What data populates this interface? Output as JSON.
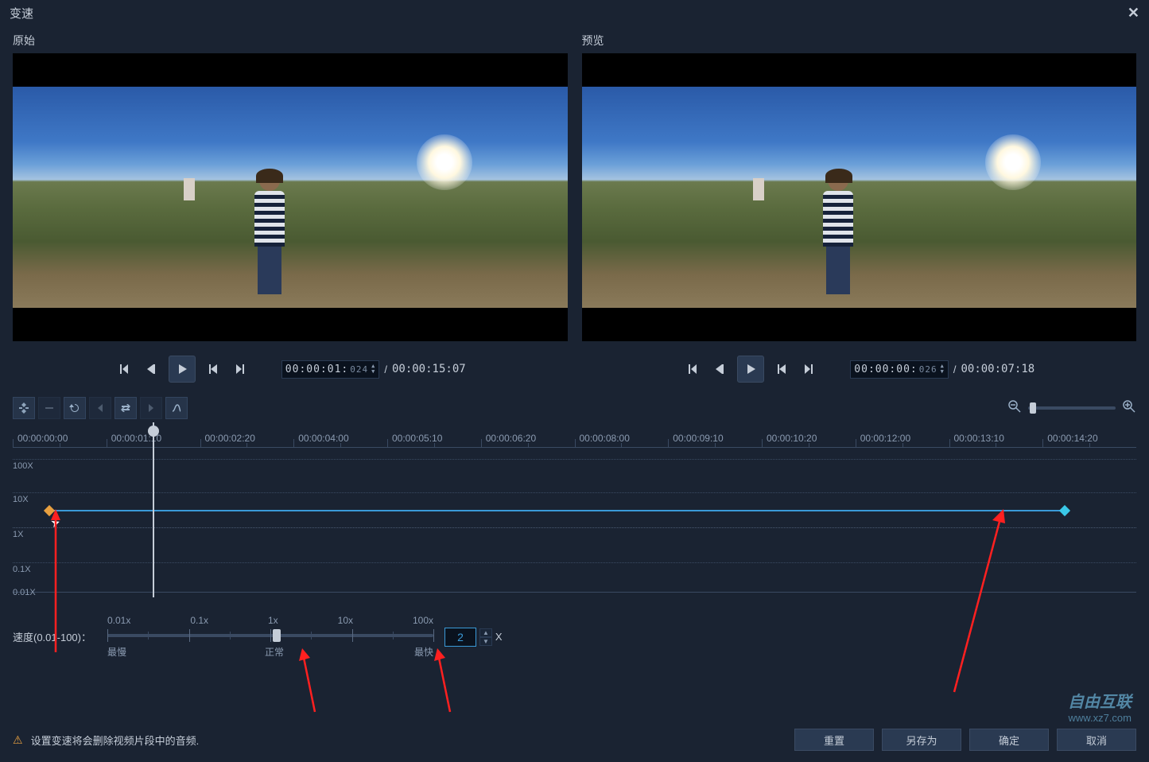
{
  "window": {
    "title": "变速"
  },
  "previews": {
    "original_label": "原始",
    "preview_label": "预览"
  },
  "playback": {
    "original": {
      "timecode_main": "00:00:01:",
      "timecode_frames": "024",
      "total": "00:00:15:07"
    },
    "preview": {
      "timecode_main": "00:00:00:",
      "timecode_frames": "026",
      "total": "00:00:07:18"
    }
  },
  "timeline": {
    "ticks": [
      "00:00:00:00",
      "00:00:01:10",
      "00:00:02:20",
      "00:00:04:00",
      "00:00:05:10",
      "00:00:06:20",
      "00:00:08:00",
      "00:00:09:10",
      "00:00:10:20",
      "00:00:12:00",
      "00:00:13:10",
      "00:00:14:20"
    ],
    "y_labels": {
      "l100": "100X",
      "l10": "10X",
      "l1": "1X",
      "l01": "0.1X",
      "l001": "0.01X"
    }
  },
  "speed": {
    "label": "速度(0.01-100)：",
    "scale": {
      "t1": "0.01x",
      "t2": "0.1x",
      "t3": "1x",
      "t4": "10x",
      "t5": "100x"
    },
    "desc": {
      "slow": "最慢",
      "normal": "正常",
      "fast": "最快"
    },
    "value": "2",
    "suffix": "X"
  },
  "warning": {
    "text": "设置变速将会删除视频片段中的音频."
  },
  "buttons": {
    "reset": "重置",
    "save_as": "另存为",
    "ok": "确定",
    "cancel": "取消"
  },
  "watermark": {
    "line1": "自由互联",
    "line2": "www.xz7.com"
  }
}
